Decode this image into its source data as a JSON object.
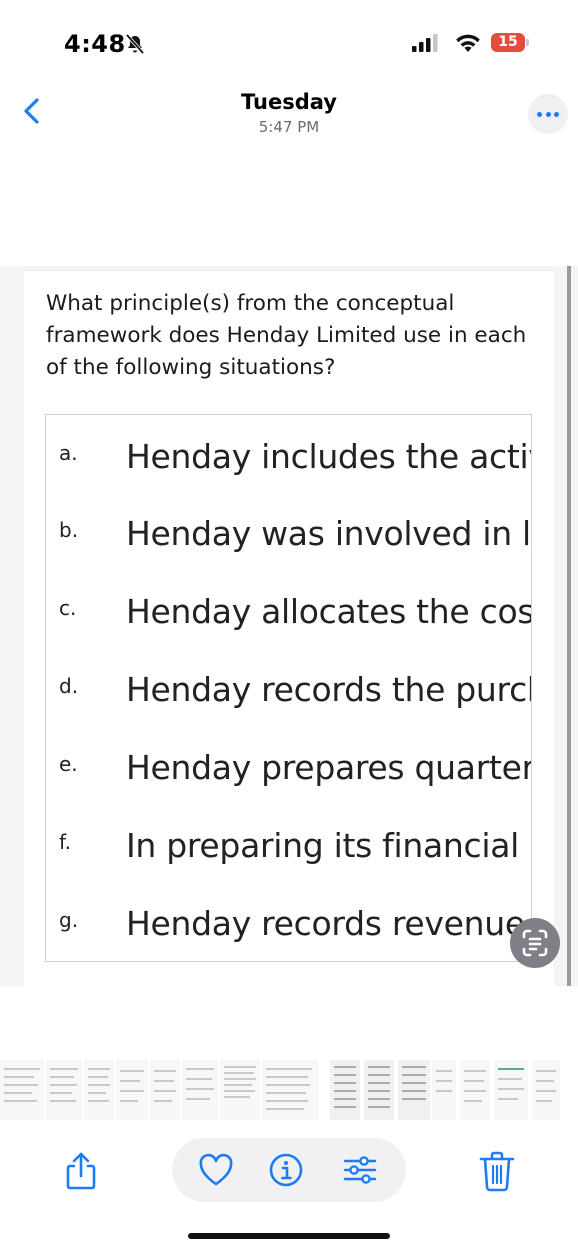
{
  "status_bar": {
    "time": "4:48",
    "battery": "15"
  },
  "header": {
    "title": "Tuesday",
    "subtitle": "5:47 PM"
  },
  "photo": {
    "question": "What principle(s) from the conceptual framework does Henday Limited use in each of the following situations?",
    "options": [
      {
        "letter": "a.",
        "text": "Henday includes the activiti"
      },
      {
        "letter": "b.",
        "text": "Henday was involved in litig"
      },
      {
        "letter": "c.",
        "text": "Henday allocates the cost of"
      },
      {
        "letter": "d.",
        "text": "Henday records the purchas"
      },
      {
        "letter": "e.",
        "text": "Henday prepares quarterly"
      },
      {
        "letter": "f.",
        "text": "In preparing its financial sta"
      },
      {
        "letter": "g.",
        "text": "Henday records revenue wh"
      }
    ]
  },
  "icons": {
    "back": "chevron-left-icon",
    "more": "ellipsis-icon",
    "live_text": "live-text-icon",
    "share": "share-icon",
    "favorite": "heart-icon",
    "info": "info-icon",
    "adjust": "adjust-icon",
    "delete": "trash-icon"
  },
  "colors": {
    "accent": "#1e7cf2",
    "battery": "#e64b3f"
  }
}
